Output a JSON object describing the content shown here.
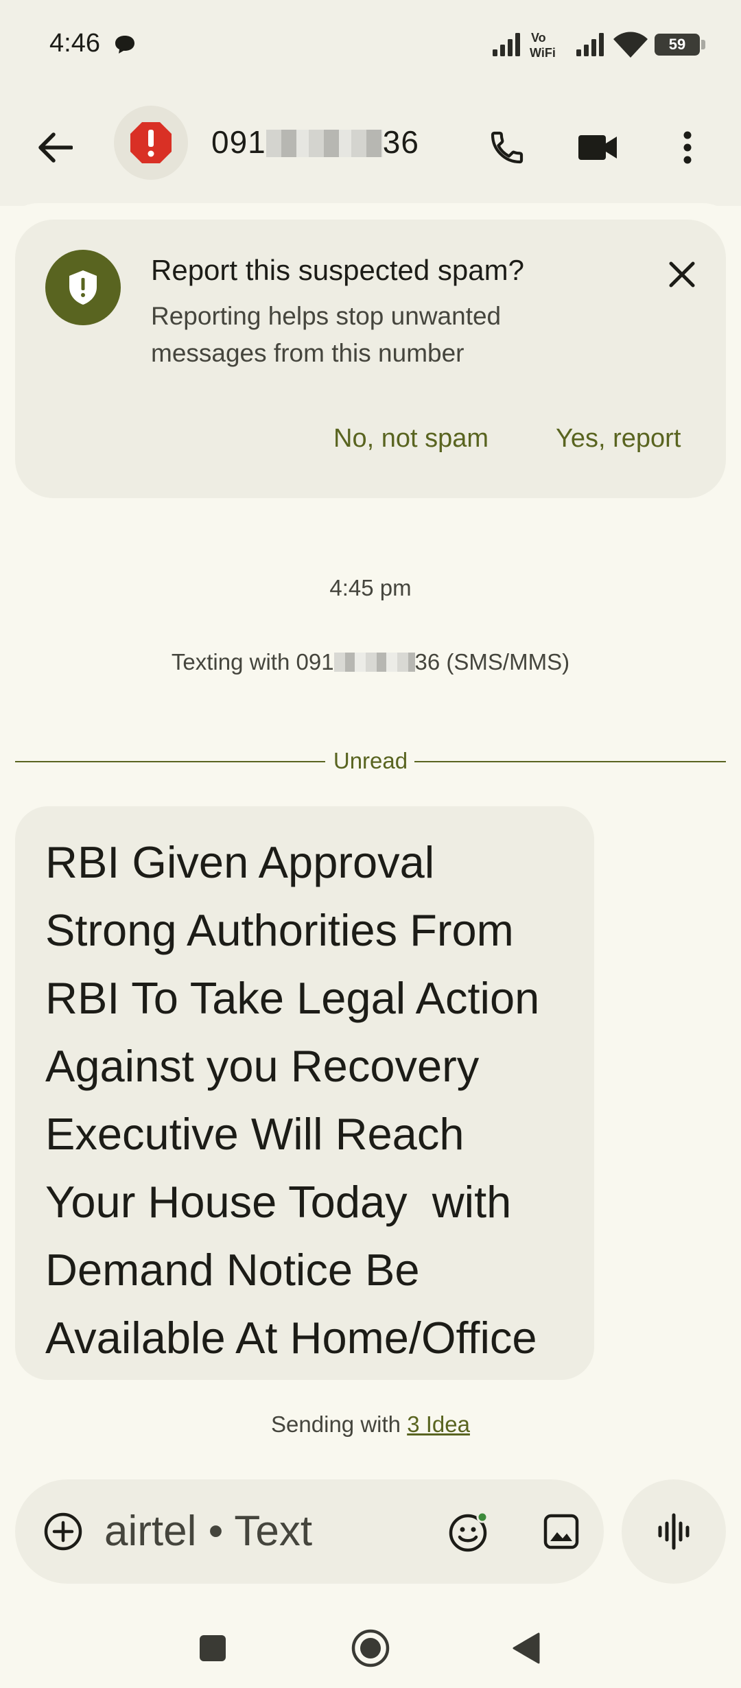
{
  "status_bar": {
    "time": "4:46",
    "network_label": "Vo WiFi",
    "battery_level": "59"
  },
  "header": {
    "contact_prefix": "091",
    "contact_suffix": "36"
  },
  "spam_card": {
    "title": "Report this suspected spam?",
    "body": "Reporting helps stop unwanted messages from this number",
    "no_label": "No, not spam",
    "yes_label": "Yes, report"
  },
  "conversation": {
    "timestamp": "4:45 pm",
    "texting_prefix": "Texting with 091",
    "texting_suffix": "36 (SMS/MMS)",
    "unread_label": "Unread",
    "message": "RBI Given Approval\nStrong Authorities From\nRBI To Take Legal Action\nAgainst you Recovery\nExecutive Will Reach\nYour House Today  with\nDemand Notice Be\nAvailable At Home/Office",
    "sending_prefix": "Sending with ",
    "sending_carrier": "3 Idea"
  },
  "composer": {
    "placeholder": "airtel • Text"
  },
  "colors": {
    "accent": "#596420",
    "surface": "#eeede3",
    "background": "#f9f8ef",
    "alert_red": "#d93025"
  },
  "icons": [
    "chat-bubble-icon",
    "signal-icon",
    "wifi-icon",
    "battery-icon",
    "back-arrow-icon",
    "alert-octagon-icon",
    "phone-icon",
    "video-camera-icon",
    "more-vert-icon",
    "shield-icon",
    "close-icon",
    "add-circle-icon",
    "emoji-icon",
    "image-icon",
    "voice-wave-icon",
    "recents-square-icon",
    "home-circle-icon",
    "back-triangle-icon"
  ]
}
